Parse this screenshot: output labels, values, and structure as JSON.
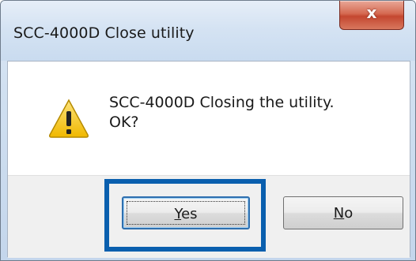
{
  "window": {
    "title": "SCC-4000D Close utility",
    "close_glyph": "x"
  },
  "dialog": {
    "icon": "warning-icon",
    "message_line1": "SCC-4000D Closing the utility.",
    "message_line2": "OK?"
  },
  "buttons": {
    "yes": {
      "accel": "Y",
      "rest": "es"
    },
    "no": {
      "accel": "N",
      "rest": "o"
    }
  },
  "colors": {
    "highlight": "#0a5fae",
    "warning": "#f2c200",
    "close_button": "#c44730"
  }
}
